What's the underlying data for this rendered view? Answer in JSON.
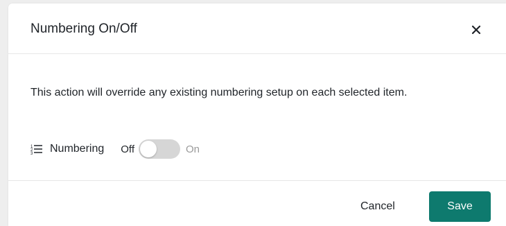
{
  "dialog": {
    "title": "Numbering On/Off",
    "close_icon": "close-icon",
    "message": "This action will override any existing numbering setup on each selected item.",
    "numbering": {
      "icon": "numbered-list-icon",
      "label": "Numbering",
      "off_label": "Off",
      "on_label": "On",
      "enabled": false
    },
    "footer": {
      "cancel_label": "Cancel",
      "save_label": "Save"
    }
  },
  "colors": {
    "primary": "#0e7a6e",
    "toggle_off": "#d6d6d6",
    "muted_text": "#9a9a9a"
  }
}
